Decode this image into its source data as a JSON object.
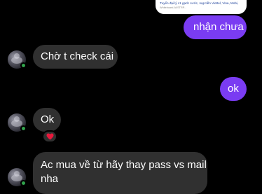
{
  "preview_card": {
    "line1": "Tuyển đại lý c1 gạch cước, nạp tiền Viettel, Vina, Mobi,",
    "line2": "Whiteboard.AI/STRP..."
  },
  "messages": [
    {
      "direction": "outgoing",
      "text": "nhận chưa"
    },
    {
      "direction": "incoming",
      "text": "Chờ t check cái"
    },
    {
      "direction": "outgoing",
      "text": "ok"
    },
    {
      "direction": "incoming",
      "text": "Ok",
      "reaction": "heart"
    },
    {
      "direction": "incoming",
      "line1": "Ac mua về từ hãy thay pass vs mail",
      "line2": "nha"
    }
  ],
  "colors": {
    "background": "#000000",
    "outgoing_bubble": "#7a3cf2",
    "incoming_bubble": "#303030",
    "online_indicator": "#31a24c",
    "reaction_heart": "#e8193c"
  },
  "icons": {
    "reaction": "heart-icon",
    "avatar": "avatar-image"
  }
}
